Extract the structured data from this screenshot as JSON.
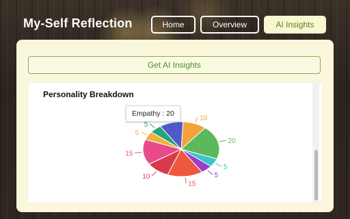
{
  "app": {
    "title": "My-Self Reflection"
  },
  "nav": {
    "home": "Home",
    "overview": "Overview",
    "ai_insights": "AI Insights"
  },
  "actions": {
    "get_insights": "Get AI Insights"
  },
  "card": {
    "title": "Personality Breakdown"
  },
  "tooltip": {
    "text": "Empathy : 20"
  },
  "colors": {
    "accent_green": "#4a8f2c",
    "panel_bg": "#fbf7dc",
    "active_nav_bg": "#f7f7d2"
  },
  "chart_data": {
    "type": "pie",
    "title": "Personality Breakdown",
    "slices": [
      {
        "value": 10,
        "color": "#f2a23c"
      },
      {
        "value": 20,
        "color": "#5cb85c"
      },
      {
        "value": 5,
        "color": "#3cc4cf"
      },
      {
        "value": 5,
        "color": "#9b3fc8"
      },
      {
        "value": 15,
        "color": "#f0573f"
      },
      {
        "value": 10,
        "color": "#d83a4a"
      },
      {
        "value": 15,
        "color": "#e94a8a"
      },
      {
        "value": 5,
        "color": "#f0b13c"
      },
      {
        "value": 5,
        "color": "#26a37a"
      },
      {
        "value": 10,
        "color": "#4f59c9"
      }
    ],
    "highlighted": {
      "label": "Empathy",
      "value": 20
    }
  }
}
